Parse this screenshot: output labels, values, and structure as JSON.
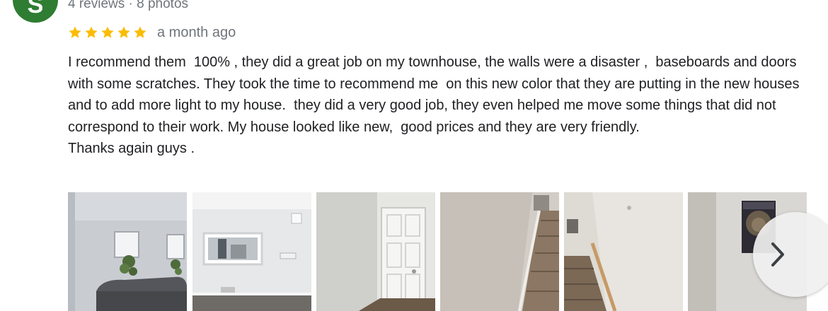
{
  "reviewer": {
    "avatar_initial": "S",
    "meta": "4 reviews · 8 photos"
  },
  "rating": {
    "stars": 5,
    "star_color": "#fbbc04",
    "time": "a month ago"
  },
  "review": {
    "text": "I recommend them  100% , they did a great job on my townhouse, the walls were a disaster ,  baseboards and doors with some scratches. They took the time to recommend me  on this new color that they are putting in the new houses and to add more light to my house.  they did a very good job, they even helped me move some things that did not correspond to their work. My house looked like new,  good prices and they are very friendly.",
    "closing": "Thanks again guys ."
  },
  "photos": [
    {
      "icon": "living-room-photo"
    },
    {
      "icon": "kitchen-mirror-photo"
    },
    {
      "icon": "white-door-photo"
    },
    {
      "icon": "staircase-wall-photo"
    },
    {
      "icon": "stair-handrail-photo"
    },
    {
      "icon": "wall-poster-photo"
    }
  ],
  "carousel": {
    "next_icon": "chevron-right-icon"
  }
}
